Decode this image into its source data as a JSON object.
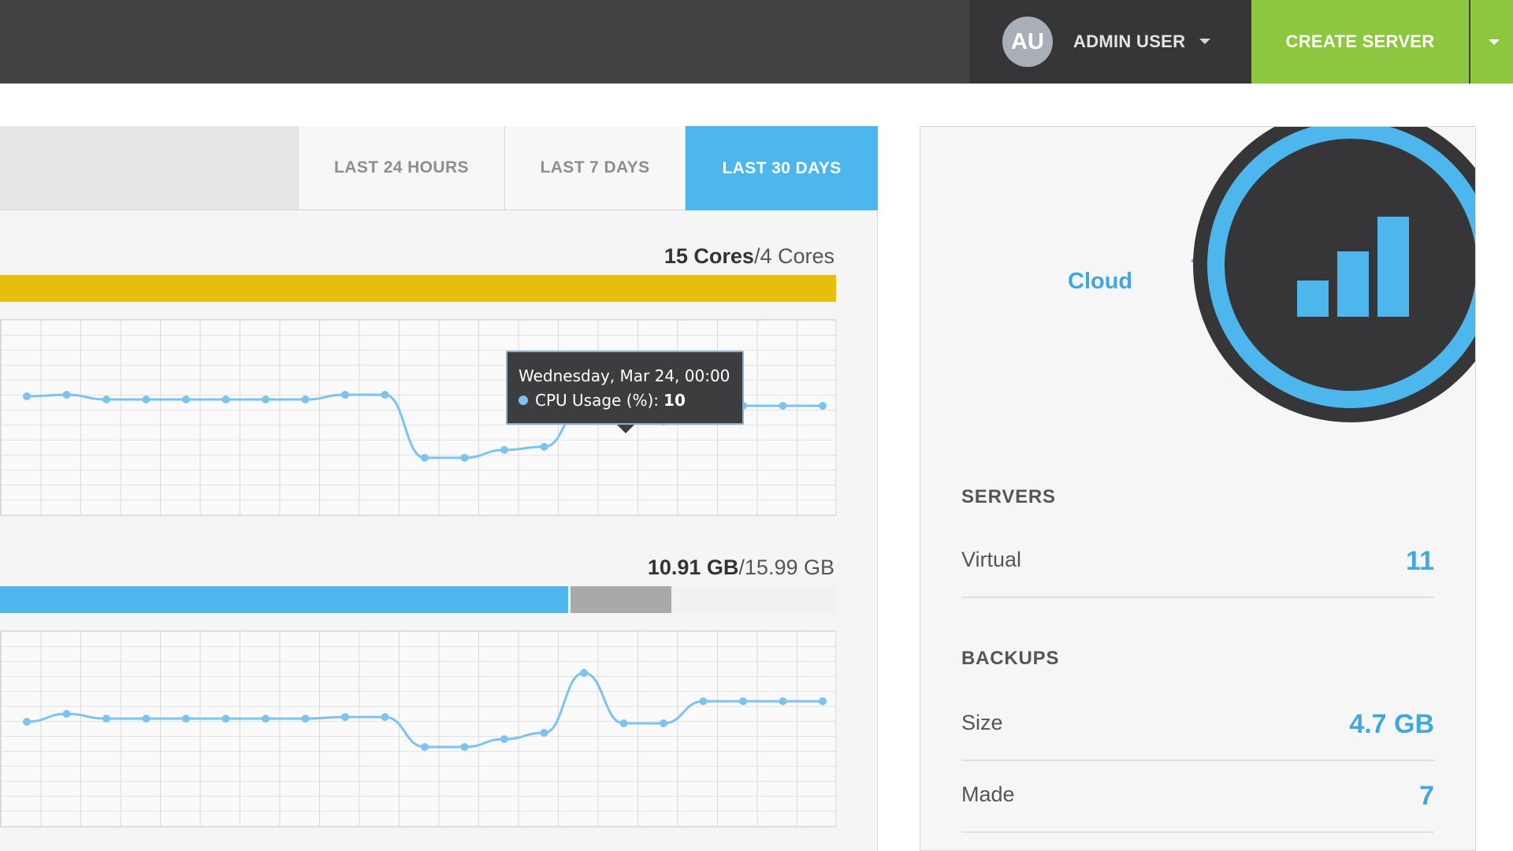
{
  "header": {
    "avatar_initials": "AU",
    "user_name": "ADMIN USER",
    "create_button_label": "CREATE SERVER"
  },
  "tabs": [
    {
      "label": "LAST 24 HOURS",
      "active": false
    },
    {
      "label": "LAST 7 DAYS",
      "active": false
    },
    {
      "label": "LAST 30 DAYS",
      "active": true
    }
  ],
  "cpu": {
    "used_label": "15 Cores",
    "total_label": "/4 Cores",
    "bar_color": "#e5bf0b",
    "bar_fraction": 1.0
  },
  "memory": {
    "used_label": "10.91 GB",
    "total_label": "/15.99 GB",
    "used_color": "#4db6ec",
    "secondary_color": "#a9a9a9",
    "used_fraction": 0.68,
    "secondary_fraction": 0.12
  },
  "tooltip": {
    "date": "Wednesday, Mar 24, 00:00",
    "series_label": "CPU Usage (%):",
    "value": "10"
  },
  "chart_data": [
    {
      "type": "line",
      "series": [
        {
          "values": [
            26,
            27,
            24,
            24,
            24,
            24,
            24,
            24,
            27,
            27,
            -13,
            -13,
            -8,
            -6,
            20,
            10,
            10,
            20,
            20,
            20,
            20
          ]
        }
      ],
      "color": "#7cc4ef"
    },
    {
      "type": "line",
      "series": [
        {
          "values": [
            17,
            22,
            19,
            19,
            19,
            19,
            19,
            19,
            20,
            20,
            1,
            1,
            6,
            10,
            48,
            16,
            16,
            30,
            30,
            30,
            30
          ]
        }
      ],
      "color": "#7cc4ef"
    }
  ],
  "right": {
    "cloud_label": "Cloud",
    "accent": "#3fa9df",
    "servers_title": "SERVERS",
    "virtual_label": "Virtual",
    "virtual_value": "11",
    "backups_title": "BACKUPS",
    "size_label": "Size",
    "size_value": "4.7 GB",
    "made_label": "Made",
    "made_value": "7"
  }
}
